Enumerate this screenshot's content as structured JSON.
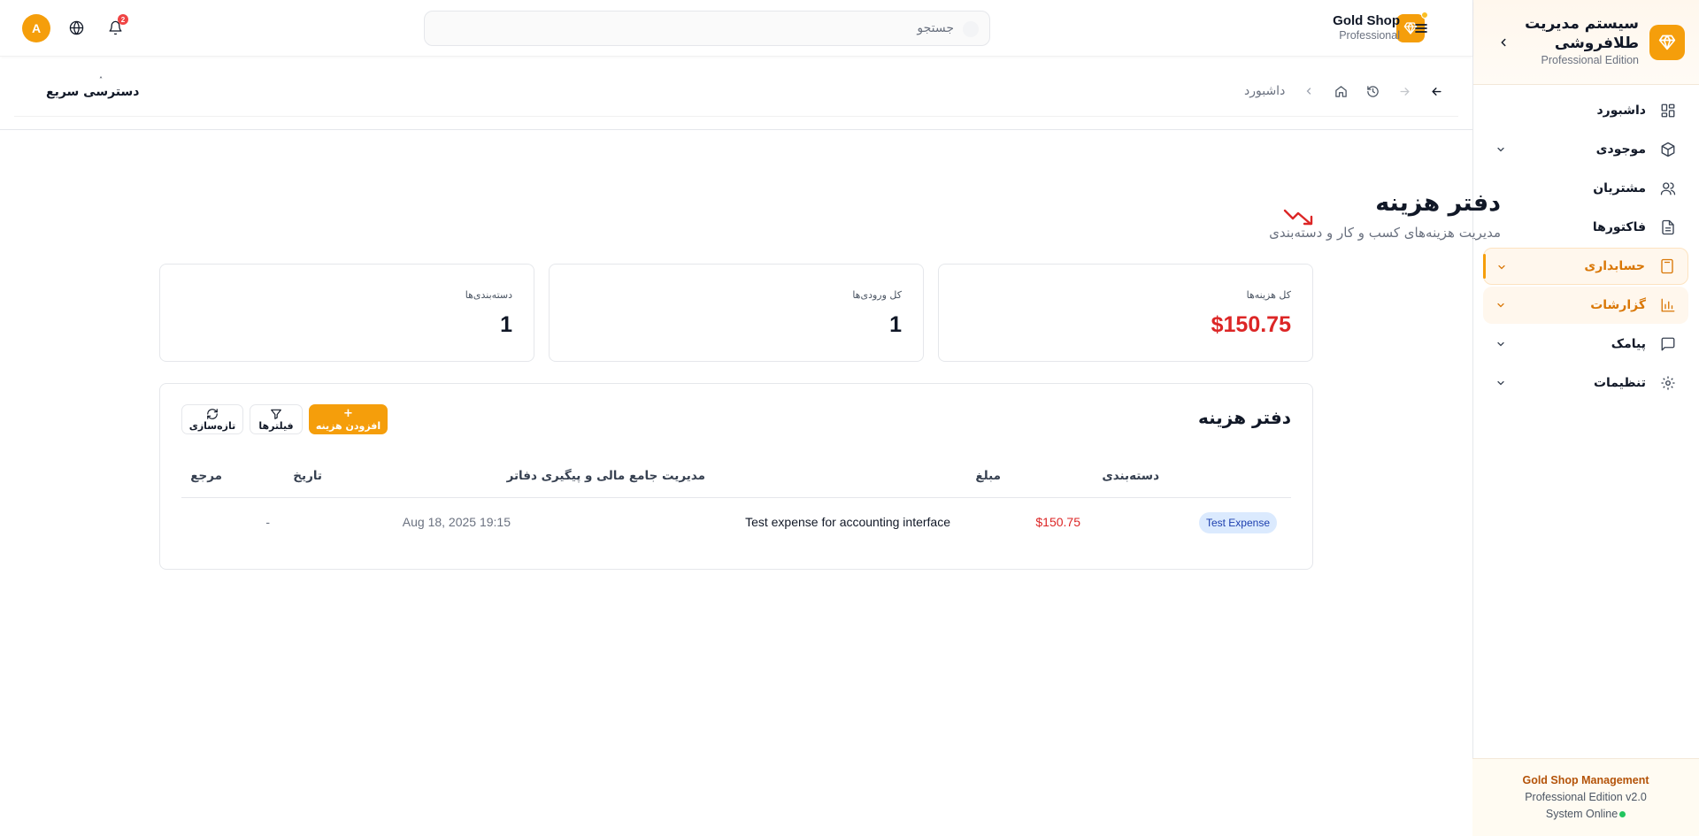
{
  "sidebar": {
    "title": "سیستم مدیریت طلافروشی",
    "subtitle": "Professional Edition",
    "items": [
      {
        "label": "داشبورد",
        "icon": "dashboard-icon",
        "chevron": false
      },
      {
        "label": "موجودی",
        "icon": "package-icon",
        "chevron": true
      },
      {
        "label": "مشتریان",
        "icon": "users-icon",
        "chevron": false
      },
      {
        "label": "فاکتورها",
        "icon": "document-icon",
        "chevron": false
      },
      {
        "label": "حسابداری",
        "icon": "calculator-icon",
        "chevron": true,
        "state": "active"
      },
      {
        "label": "گزارشات",
        "icon": "bar-chart-icon",
        "chevron": true,
        "state": "highlighted"
      },
      {
        "label": "پیامک",
        "icon": "message-icon",
        "chevron": true
      },
      {
        "label": "تنظیمات",
        "icon": "gear-icon",
        "chevron": true
      }
    ],
    "footer": {
      "name": "Gold Shop Management",
      "edition": "Professional Edition v2.0",
      "status": "System Online"
    }
  },
  "header": {
    "avatar_letter": "A",
    "notification_count": "2",
    "search_placeholder": "جستجو",
    "brand_name": "Gold Shop",
    "brand_sub": "Professional"
  },
  "breadcrumb": {
    "current": "داشبورد",
    "quick_access": "دسترسی سریع"
  },
  "page": {
    "title": "دفتر هزینه",
    "subtitle": "مدیریت هزینه‌های کسب و کار و دسته‌بندی"
  },
  "stats": [
    {
      "label": "کل هزینه‌ها",
      "value": "$150.75"
    },
    {
      "label": "کل ورودی‌ها",
      "value": "1"
    },
    {
      "label": "دسته‌بندی‌ها",
      "value": "1"
    }
  ],
  "table": {
    "title": "دفتر هزینه",
    "buttons": {
      "add": "افزودن هزینه",
      "filters": "فیلترها",
      "refresh": "تازه‌سازی"
    },
    "columns": {
      "category": "دسته‌بندی",
      "amount": "مبلغ",
      "description": "مدیریت جامع مالی و پیگیری دفاتر",
      "date": "تاریخ",
      "reference": "مرجع"
    },
    "rows": [
      {
        "category": "Test Expense",
        "amount": "$150.75",
        "description": "Test expense for accounting interface",
        "date": "Aug 18, 2025 19:15",
        "reference": "-"
      }
    ]
  },
  "colors": {
    "accent": "#f59e0b",
    "accent_text": "#d97706",
    "negative": "#dc2626",
    "tag_bg": "#dbeafe",
    "tag_text": "#1e40af",
    "online": "#22c55e"
  }
}
